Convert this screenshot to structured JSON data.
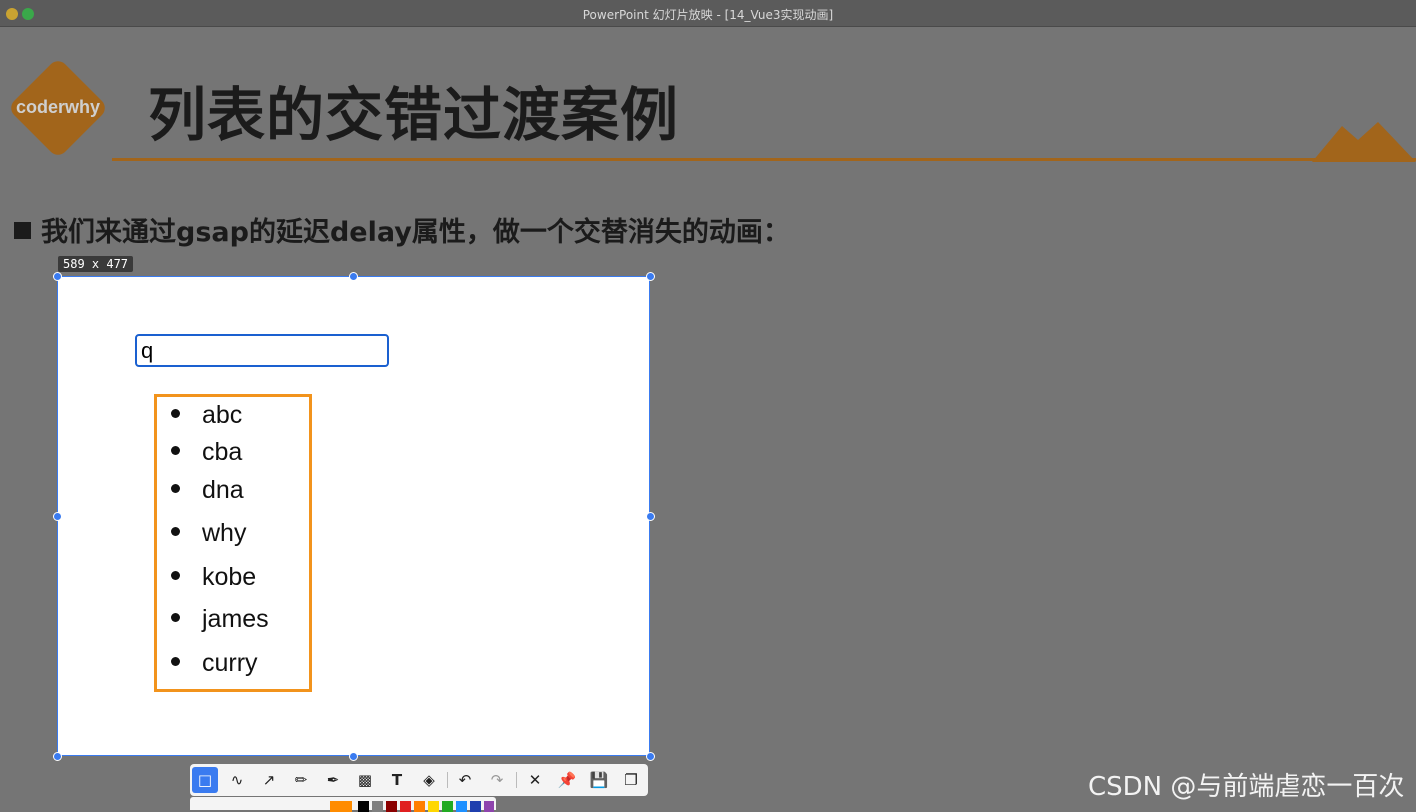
{
  "window": {
    "title": "PowerPoint 幻灯片放映 - [14_Vue3实现动画]"
  },
  "slide": {
    "logo_text": "coderwhy",
    "title": "列表的交错过渡案例",
    "bullet": "我们来通过gsap的延迟delay属性，做一个交替消失的动画："
  },
  "capture": {
    "size_label": "589 x 477",
    "input_value": "q",
    "list_items": [
      "abc",
      "cba",
      "dna",
      "why",
      "kobe",
      "james",
      "curry"
    ]
  },
  "toolbar": {
    "tools": [
      "select-rect-icon",
      "polyline-icon",
      "arrow-icon",
      "pencil-icon",
      "marker-icon",
      "mosaic-icon",
      "text-icon",
      "eraser-icon",
      "undo-icon",
      "redo-icon",
      "close-icon",
      "pin-icon",
      "save-icon",
      "copy-icon"
    ],
    "palette": [
      "#ff8c00",
      "#000000",
      "#7f7f7f",
      "#8b0000",
      "#e02020",
      "#ff7f00",
      "#ffd700",
      "#22aa22",
      "#1e90ff",
      "#1f3fae",
      "#8e44ad"
    ]
  },
  "colors": {
    "accent": "#a2651b",
    "selection": "#3a7bf0",
    "list_border": "#f2931c"
  },
  "watermark": "CSDN @与前端虐恋一百次"
}
